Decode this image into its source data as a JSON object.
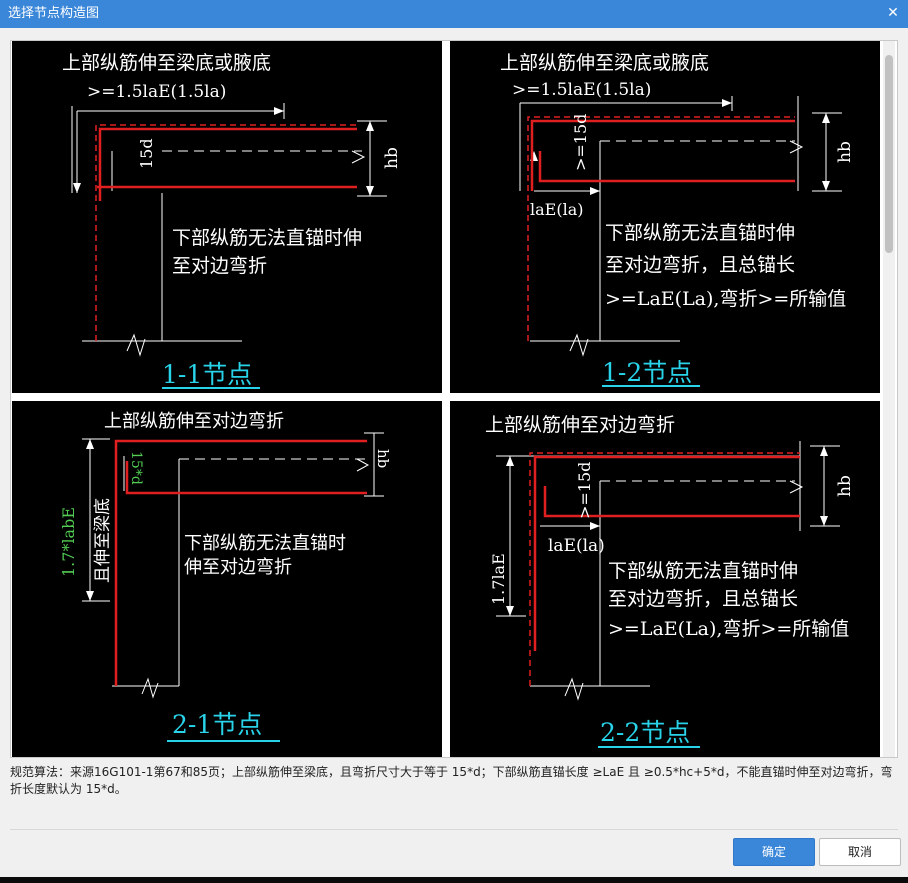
{
  "window": {
    "title": "选择节点构造图",
    "close_icon": "close-icon"
  },
  "panels": [
    {
      "id": "1-1",
      "top_label": "上部纵筋伸至梁底或腋底",
      "dim_label": ">=1.5laE(1.5la)",
      "bend_label": "15d",
      "hb_label": "hb",
      "note_lines": [
        "下部纵筋无法直锚时伸",
        "至对边弯折"
      ],
      "caption": "1-1节点"
    },
    {
      "id": "1-2",
      "top_label": "上部纵筋伸至梁底或腋底",
      "dim_label": ">=1.5laE(1.5la)",
      "bend_label": ">=15d",
      "hb_label": "hb",
      "anchor_label": "laE(la)",
      "note_lines": [
        "下部纵筋无法直锚时伸",
        "至对边弯折，且总锚长",
        ">=LaE(La),弯折>=所输值"
      ],
      "caption": "1-2节点"
    },
    {
      "id": "2-1",
      "top_label": "上部纵筋伸至对边弯折",
      "bend_label": "15*d",
      "hb_label": "hb",
      "side_label_green": "1.7*labE",
      "side_label_white": "且伸至梁底",
      "note_lines": [
        "下部纵筋无法直锚时",
        "伸至对边弯折"
      ],
      "caption": "2-1节点"
    },
    {
      "id": "2-2",
      "top_label": "上部纵筋伸至对边弯折",
      "bend_label": ">=15d",
      "hb_label": "hb",
      "side_label": "1.7laE",
      "anchor_label": "laE(la)",
      "note_lines": [
        "下部纵筋无法直锚时伸",
        "至对边弯折，且总锚长",
        ">=LaE(La),弯折>=所输值"
      ],
      "caption": "2-2节点"
    }
  ],
  "description": "规范算法：来源16G101-1第67和85页；上部纵筋伸至梁底，且弯折尺寸大于等于 15*d；下部纵筋直锚长度 ≥LaE 且 ≥0.5*hc+5*d，不能直锚时伸至对边弯折，弯折长度默认为 15*d。",
  "buttons": {
    "ok": "确定",
    "cancel": "取消"
  },
  "colors": {
    "titlebar": "#3a86d8",
    "rebar": "#e02020",
    "caption": "#29d3e9",
    "dimension": "#52cc52",
    "panel_bg": "#000000"
  }
}
